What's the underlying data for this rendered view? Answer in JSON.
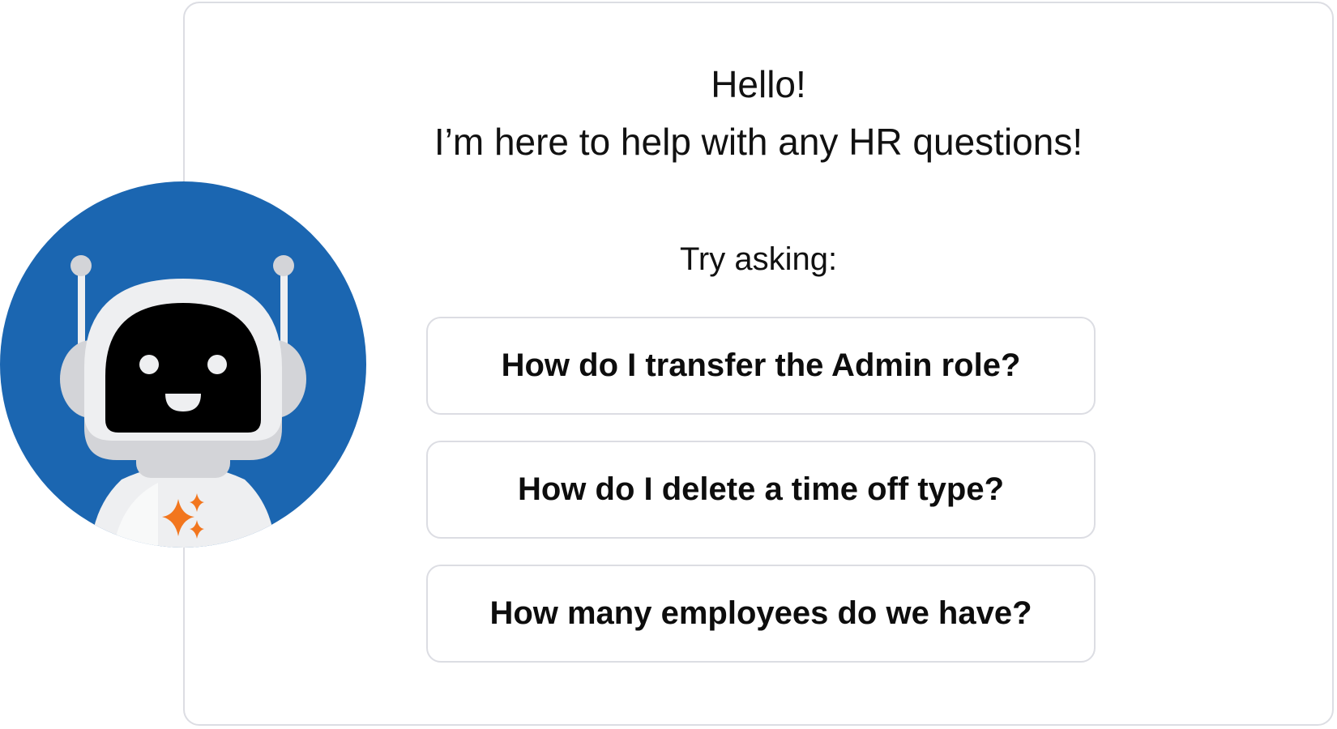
{
  "greeting": {
    "hello": "Hello!",
    "intro": "I’m here to help with any HR questions!"
  },
  "prompt_label": "Try asking:",
  "suggestions": [
    {
      "label": "How do I transfer the Admin role?"
    },
    {
      "label": "How do I delete a time off type?"
    },
    {
      "label": "How many employees do we have?"
    }
  ],
  "colors": {
    "avatar_background": "#1b66b1",
    "robot_face": "#000000",
    "robot_body": "#eeeff1",
    "sparkle": "#f2761e",
    "card_border": "#dcdde3"
  },
  "icons": {
    "avatar": "robot-assistant-icon",
    "chest": "sparkle-icon"
  }
}
